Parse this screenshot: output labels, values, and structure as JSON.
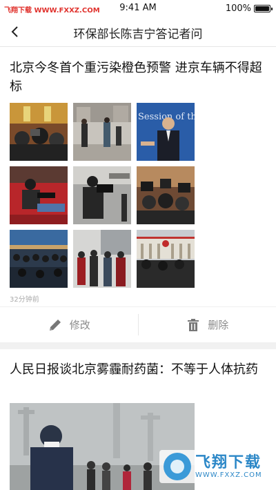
{
  "status_bar": {
    "watermark": "飞翔下载 WWW.FXXZ.COM",
    "time": "9:41 AM",
    "battery": "100%",
    "battery_level": 1.0
  },
  "nav": {
    "title": "环保部长陈吉宁答记者问",
    "back_icon": "chevron-left-icon"
  },
  "article1": {
    "title": "北京今冬首个重污染橙色预警 进京车辆不得超标",
    "time": "32分钟前",
    "photos": [
      "press-photo-1",
      "press-photo-2",
      "press-photo-3",
      "press-photo-4",
      "press-photo-5",
      "press-photo-6",
      "press-photo-7",
      "press-photo-8",
      "press-photo-9"
    ],
    "photo_overlay_text": "Session of th"
  },
  "actions": {
    "edit_label": "修改",
    "delete_label": "删除",
    "edit_icon": "pencil-icon",
    "delete_icon": "trash-icon"
  },
  "article2": {
    "title": "人民日报谈北京雾霾耐药菌：不等于人体抗药"
  },
  "watermark_logo": {
    "name": "飞翔下载",
    "url": "WWW.FXXZ.COM"
  },
  "colors": {
    "watermark_red": "#e0322d",
    "icon_gray": "#8a8a8a",
    "separator": "#f1f1f1",
    "logo_blue": "#2b87c7"
  }
}
